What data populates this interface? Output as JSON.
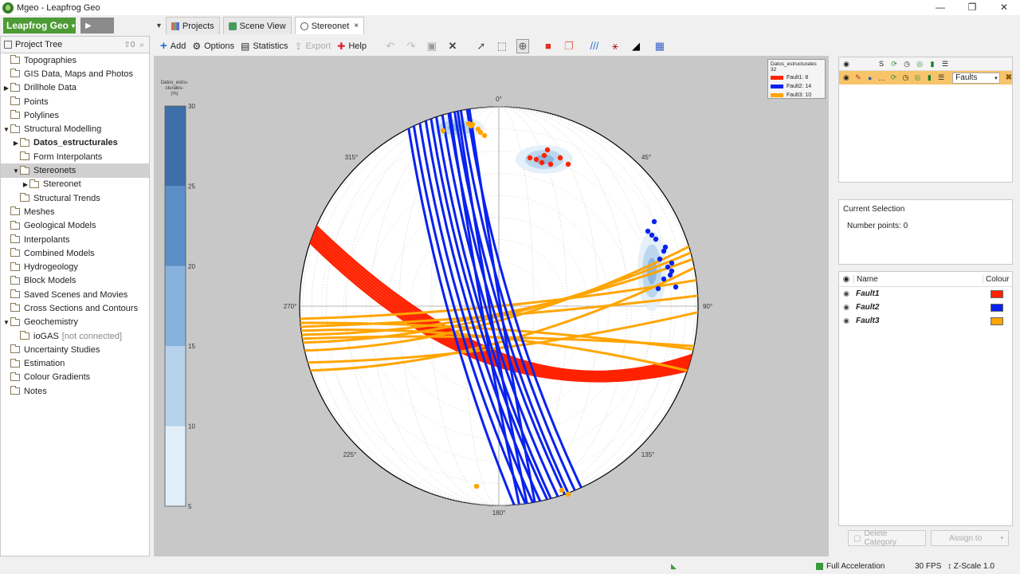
{
  "window": {
    "title": "Mgeo - Leapfrog Geo",
    "minimize": "—",
    "maximize": "❐",
    "close": "✕"
  },
  "brand": {
    "label": "Leapfrog Geo",
    "caret": "▾"
  },
  "tabs": [
    {
      "label": "Projects"
    },
    {
      "label": "Scene View"
    },
    {
      "label": "Stereonet",
      "close": "×"
    }
  ],
  "left_panel": {
    "header": "Project Tree",
    "header_count": "0",
    "items": [
      {
        "label": "Topographies",
        "indent": 0
      },
      {
        "label": "GIS Data, Maps and Photos",
        "indent": 0
      },
      {
        "label": "Drillhole Data",
        "indent": 0,
        "arrow": "▶"
      },
      {
        "label": "Points",
        "indent": 0
      },
      {
        "label": "Polylines",
        "indent": 0
      },
      {
        "label": "Structural Modelling",
        "indent": 0,
        "arrow": "▼"
      },
      {
        "label": "Datos_estructurales",
        "indent": 1,
        "arrow": "▶",
        "bold": true
      },
      {
        "label": "Form Interpolants",
        "indent": 1
      },
      {
        "label": "Stereonets",
        "indent": 1,
        "arrow": "▼",
        "selected": true
      },
      {
        "label": "Stereonet",
        "indent": 2,
        "arrow": "▶"
      },
      {
        "label": "Structural Trends",
        "indent": 1
      },
      {
        "label": "Meshes",
        "indent": 0
      },
      {
        "label": "Geological Models",
        "indent": 0
      },
      {
        "label": "Interpolants",
        "indent": 0
      },
      {
        "label": "Combined Models",
        "indent": 0
      },
      {
        "label": "Hydrogeology",
        "indent": 0
      },
      {
        "label": "Block Models",
        "indent": 0
      },
      {
        "label": "Saved Scenes and Movies",
        "indent": 0
      },
      {
        "label": "Cross Sections and Contours",
        "indent": 0
      },
      {
        "label": "Geochemistry",
        "indent": 0,
        "arrow": "▼"
      },
      {
        "label": "ioGAS",
        "indent": 1,
        "muted": "[not connected]"
      },
      {
        "label": "Uncertainty Studies",
        "indent": 0
      },
      {
        "label": "Estimation",
        "indent": 0
      },
      {
        "label": "Colour Gradients",
        "indent": 0
      },
      {
        "label": "Notes",
        "indent": 0
      }
    ]
  },
  "toolbar": {
    "add": "Add",
    "options": "Options",
    "statistics": "Statistics",
    "export": "Export",
    "help": "Help"
  },
  "colour_bar": {
    "title_lines": [
      "Datos_estru-",
      "cturales-",
      "(%)"
    ],
    "ticks": [
      "30",
      "25",
      "20",
      "15",
      "10",
      "5"
    ],
    "colors": [
      "#3f6faa",
      "#5b8fc7",
      "#86b2dd",
      "#b7d3ec",
      "#e2eef8"
    ]
  },
  "stereonet": {
    "labels": {
      "n": "0°",
      "ne": "45°",
      "e": "90°",
      "se": "135°",
      "s": "180°",
      "sw": "225°",
      "w": "270°",
      "nw": "315°"
    }
  },
  "legend": {
    "title": "Datos_estructurales 32",
    "entries": [
      {
        "label": "Fault1: 8",
        "color": "#ff2200"
      },
      {
        "label": "Fault2: 14",
        "color": "#0a22ee"
      },
      {
        "label": "Fault3: 10",
        "color": "#ffa500"
      }
    ]
  },
  "layer_panel": {
    "header_s": "S",
    "selector": "Faults"
  },
  "selection_panel": {
    "title": "Current Selection",
    "points_label": "Number points: 0"
  },
  "category_list": {
    "col_name": "Name",
    "col_colour": "Colour",
    "rows": [
      {
        "name": "Fault1",
        "color": "#ff2200"
      },
      {
        "name": "Fault2",
        "color": "#0a22ee"
      },
      {
        "name": "Fault3",
        "color": "#ffa500"
      }
    ]
  },
  "buttons": {
    "delete": "Delete Category",
    "assign": "Assign to"
  },
  "status": {
    "acceleration": "Full Acceleration",
    "fps": "30 FPS",
    "zscale": "Z-Scale 1.0"
  }
}
